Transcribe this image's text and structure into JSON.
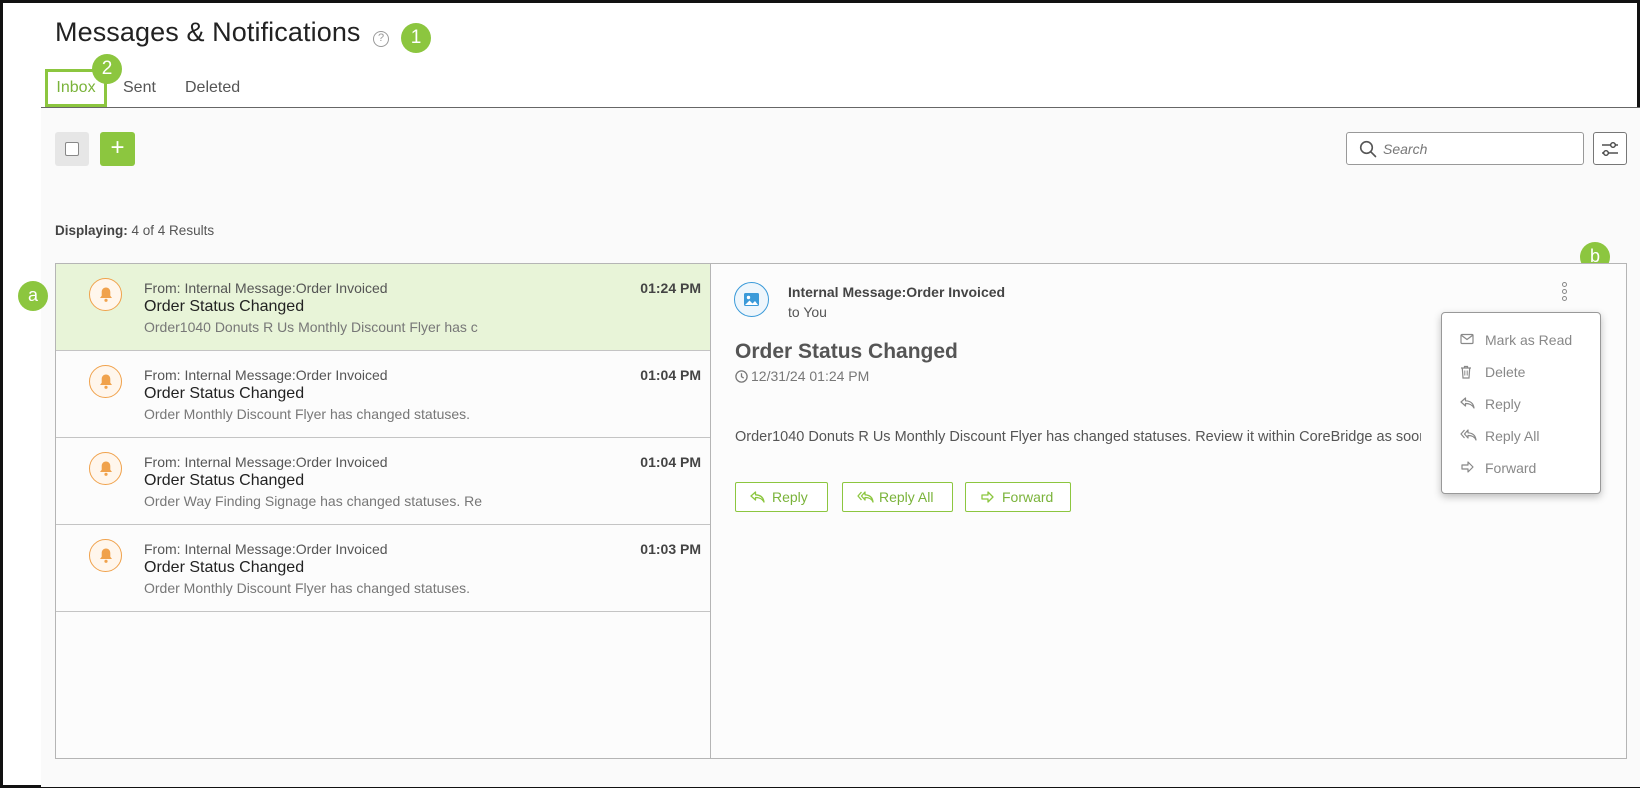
{
  "page": {
    "title": "Messages & Notifications",
    "help_icon": "question-circle-icon",
    "badges": {
      "one": "1",
      "two": "2",
      "a": "a",
      "b": "b"
    }
  },
  "tabs": [
    {
      "label": "Inbox",
      "active": true
    },
    {
      "label": "Sent",
      "active": false
    },
    {
      "label": "Deleted",
      "active": false
    }
  ],
  "toolbar": {
    "add_icon": "plus-icon",
    "add_label": "+",
    "search_placeholder": "Search",
    "filter_icon": "sliders-icon"
  },
  "results": {
    "label": "Displaying:",
    "value": "4 of 4 Results"
  },
  "messages": [
    {
      "from": "From: Internal Message:Order Invoiced",
      "subject": "Order Status Changed",
      "preview": "Order1040 Donuts R Us Monthly Discount Flyer has c",
      "time": "01:24 PM",
      "selected": true,
      "icon": "bell-icon"
    },
    {
      "from": "From: Internal Message:Order Invoiced",
      "subject": "Order Status Changed",
      "preview": "Order Monthly Discount Flyer has changed statuses.",
      "time": "01:04 PM",
      "selected": false,
      "icon": "bell-icon"
    },
    {
      "from": "From: Internal Message:Order Invoiced",
      "subject": "Order Status Changed",
      "preview": "Order Way Finding Signage has changed statuses. Re",
      "time": "01:04 PM",
      "selected": false,
      "icon": "bell-icon"
    },
    {
      "from": "From: Internal Message:Order Invoiced",
      "subject": "Order Status Changed",
      "preview": "Order Monthly Discount Flyer has changed statuses.",
      "time": "01:03 PM",
      "selected": false,
      "icon": "bell-icon"
    }
  ],
  "detail": {
    "from": "Internal Message:Order Invoiced",
    "to": "to You",
    "subject": "Order Status Changed",
    "date": "12/31/24 01:24 PM",
    "body": "Order1040 Donuts R Us Monthly Discount Flyer has changed statuses. Review it within CoreBridge as soon as possible.",
    "buttons": {
      "reply": "Reply",
      "reply_all": "Reply All",
      "forward": "Forward"
    }
  },
  "menu": [
    {
      "label": "Mark as Read",
      "icon": "envelope-icon"
    },
    {
      "label": "Delete",
      "icon": "trash-icon"
    },
    {
      "label": "Reply",
      "icon": "reply-icon"
    },
    {
      "label": "Reply All",
      "icon": "reply-all-icon"
    },
    {
      "label": "Forward",
      "icon": "forward-icon"
    }
  ],
  "colors": {
    "accent": "#8cc63f",
    "accent_text": "#7ab33a",
    "selected_row": "#e8f4d8",
    "bell": "#f0a24c",
    "avatar": "#3a9ad9"
  }
}
